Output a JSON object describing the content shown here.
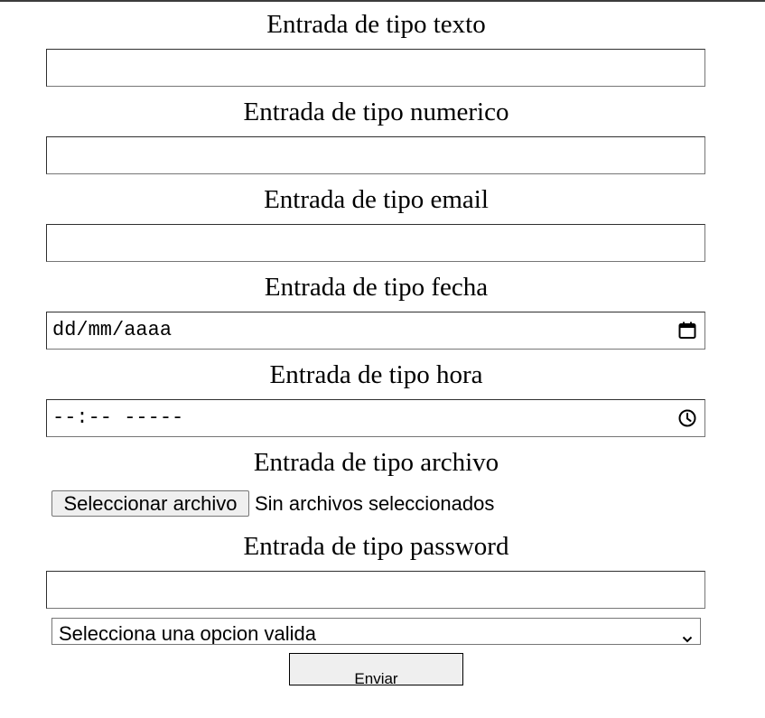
{
  "form": {
    "text": {
      "label": "Entrada de tipo texto",
      "value": ""
    },
    "number": {
      "label": "Entrada de tipo numerico",
      "value": ""
    },
    "email": {
      "label": "Entrada de tipo email",
      "value": ""
    },
    "date": {
      "label": "Entrada de tipo fecha",
      "placeholder": "dd/mm/aaaa",
      "icon": "calendar-icon"
    },
    "time": {
      "label": "Entrada de tipo hora",
      "placeholder": "--:-- -----",
      "icon": "clock-icon"
    },
    "file": {
      "label": "Entrada de tipo archivo",
      "button_label": "Seleccionar archivo",
      "status": "Sin archivos seleccionados"
    },
    "password": {
      "label": "Entrada de tipo password",
      "value": ""
    },
    "select": {
      "selected": "Selecciona una opcion valida",
      "icon": "chevron-down-icon"
    },
    "submit": {
      "label": "Enviar"
    }
  }
}
